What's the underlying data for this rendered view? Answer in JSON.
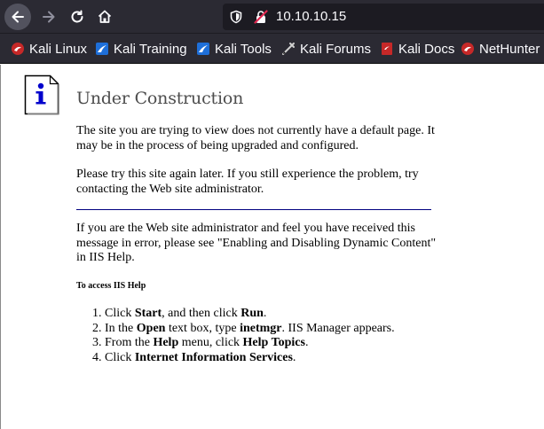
{
  "browser": {
    "url": "10.10.10.15",
    "bookmarks": [
      {
        "label": "Kali Linux",
        "icon": "kali-dragon-icon"
      },
      {
        "label": "Kali Training",
        "icon": "kali-training-icon"
      },
      {
        "label": "Kali Tools",
        "icon": "kali-tools-icon"
      },
      {
        "label": "Kali Forums",
        "icon": "kali-forums-icon"
      },
      {
        "label": "Kali Docs",
        "icon": "kali-docs-icon"
      },
      {
        "label": "NetHunter",
        "icon": "kali-dragon-icon"
      }
    ]
  },
  "page": {
    "title": "Under Construction",
    "paragraph1": "The site you are trying to view does not currently have a default page. It may be in the process of being upgraded and configured.",
    "paragraph2": "Please try this site again later. If you still experience the problem, try contacting the Web site administrator.",
    "paragraph3": "If you are the Web site administrator and feel you have received this message in error, please see \"Enabling and Disabling Dynamic Content\" in IIS Help.",
    "subheading": "To access IIS Help",
    "steps": [
      {
        "n": "1.",
        "a": "Click ",
        "b1": "Start",
        "c": ", and then click ",
        "b2": "Run",
        "d": "."
      },
      {
        "n": "2.",
        "a": "In the ",
        "b1": "Open",
        "c": " text box, type ",
        "b2": "inetmgr",
        "d": ". IIS Manager appears."
      },
      {
        "n": "3.",
        "a": "From the ",
        "b1": "Help",
        "c": " menu, click ",
        "b2": "Help Topics",
        "d": "."
      },
      {
        "n": "4.",
        "a": "Click ",
        "b1": "Internet Information Services",
        "c": "",
        "b2": "",
        "d": "."
      }
    ]
  },
  "colors": {
    "chrome_bg": "#2b2a33",
    "urlbar_bg": "#1c1b22",
    "rule": "#000080",
    "title": "#4d4d4d"
  }
}
